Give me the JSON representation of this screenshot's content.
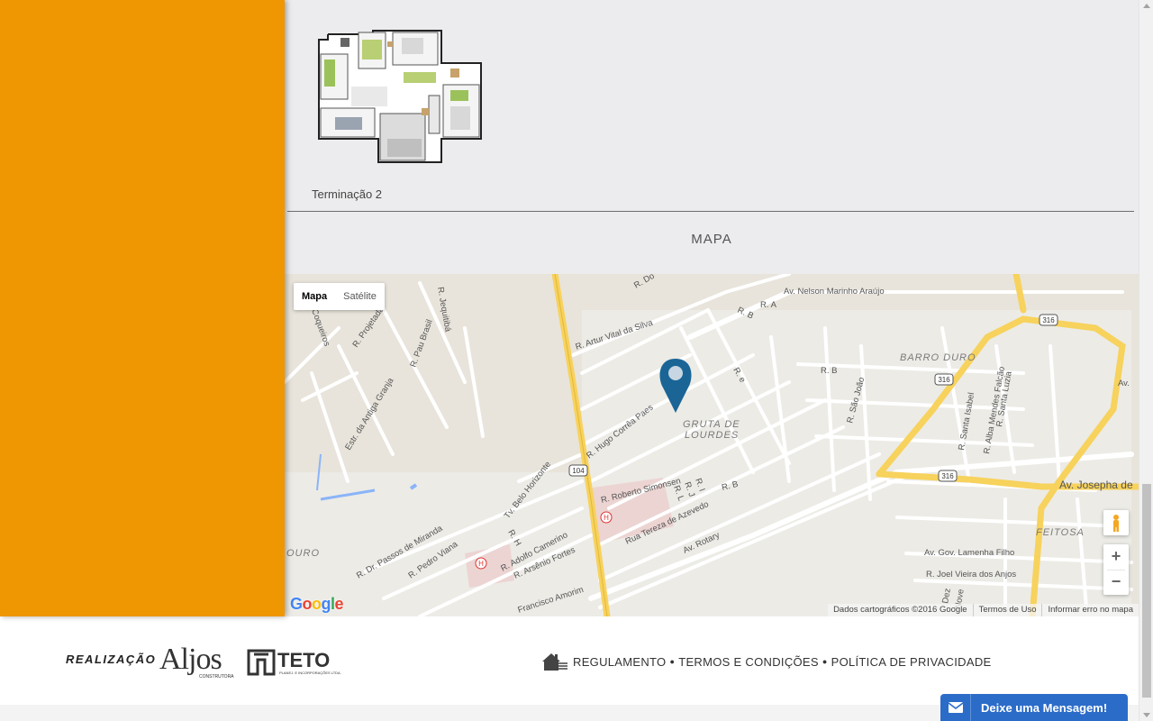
{
  "floorplan": {
    "caption": "Terminação 2"
  },
  "section": {
    "title": "MAPA"
  },
  "map": {
    "type_controls": [
      "Mapa",
      "Satélite"
    ],
    "active_type": "Mapa",
    "zoom_in": "+",
    "zoom_out": "−",
    "footer": [
      "Dados cartográficos ©2016 Google",
      "Termos de Uso",
      "Informar erro no mapa"
    ],
    "neighborhoods": [
      "GRUTA DE",
      "LOURDES",
      "BARRO DURO",
      "FEITOSA",
      "OURO"
    ],
    "streets": [
      "R. Do",
      "Av. Nelson Marinho Araújo",
      "R. B",
      "R. A",
      "R. Artur Vital da Silva",
      "R. Projetada",
      "R. Pau Brasil",
      "R. Jequitibá",
      "Coqueiros",
      "Estr. da Antiga Granja",
      "R. Hugo Corrêa Paes",
      "R. e",
      "R. B",
      "R. São João",
      "R. Santa Isabel",
      "R. Alba Mendes Falcão",
      "R. Santa Luzia",
      "Av. Josepha de",
      "Av.",
      "R. Roberto Simonsen",
      "R. I",
      "R. J",
      "R. L",
      "R. B",
      "Tv. Belo Horizonte",
      "R. H",
      "R. Dr. Passos de Miranda",
      "R. Pedro Viana",
      "R. Adolfo Camerino",
      "R. Arsênio Fortes",
      "Rua Tereza de Azevedo",
      "Av. Rotary",
      "Av. Gov. Lamenha Filho",
      "R. Joel Vieira dos Anjos",
      "Francisco Amorim",
      "Dez",
      "Nove"
    ],
    "route_shields": [
      "316",
      "316",
      "316",
      "104"
    ],
    "brand": "Google"
  },
  "footer": {
    "realizacao": "REALIZAÇÃO",
    "aljos_logo": "Aljos",
    "aljos_sub": "CONSTRUTORA",
    "teto_logo": "TETO",
    "teto_sub": "PLANEJ. E INCORPORAÇÕES LTDA.",
    "links": [
      "REGULAMENTO",
      "TERMOS E CONDIÇÕES",
      "POLÍTICA DE PRIVACIDADE"
    ]
  },
  "chat": {
    "label": "Deixe uma Mensagem!"
  },
  "colors": {
    "sidebar": "#ef9603",
    "map_pin": "#1a6596",
    "chat": "#2b6cc9",
    "highway": "#f7d25c"
  }
}
